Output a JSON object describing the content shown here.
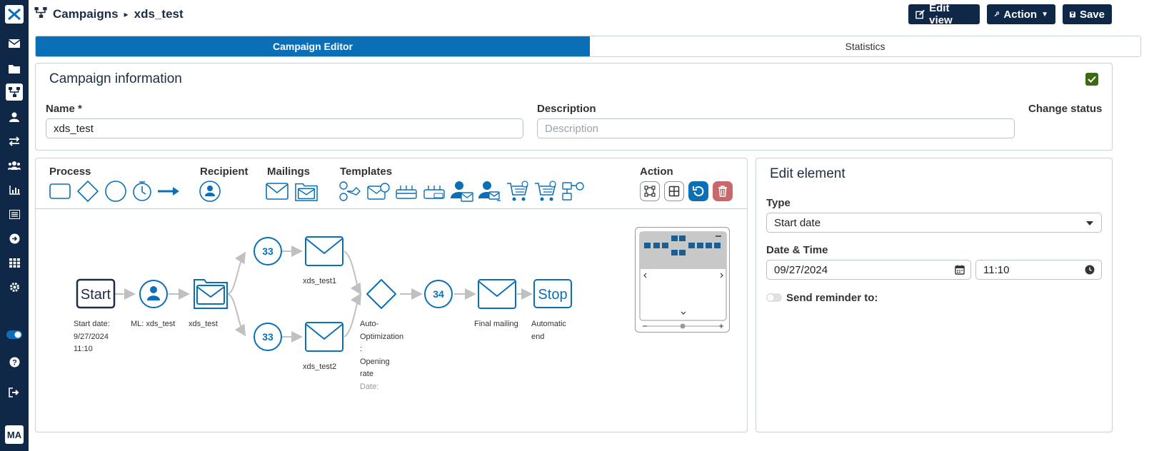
{
  "breadcrumb": {
    "root": "Campaigns",
    "current": "xds_test"
  },
  "header_buttons": {
    "edit_view": "Edit view",
    "action": "Action",
    "save": "Save"
  },
  "tabs": [
    {
      "label": "Campaign Editor",
      "active": true
    },
    {
      "label": "Statistics",
      "active": false
    }
  ],
  "campaign_info": {
    "title": "Campaign information",
    "name_label": "Name *",
    "name_value": "xds_test",
    "description_label": "Description",
    "description_placeholder": "Description",
    "change_status_label": "Change status"
  },
  "toolbar": {
    "process": "Process",
    "recipient": "Recipient",
    "mailings": "Mailings",
    "templates": "Templates",
    "action": "Action"
  },
  "nodes": {
    "start": "Start",
    "stop": "Stop",
    "counter_a": "33",
    "counter_b": "33",
    "counter_c": "34"
  },
  "node_labels": {
    "start_line1": "Start date:",
    "start_line2": "9/27/2024",
    "start_line3": "11:10",
    "recipient": "ML: xds_test",
    "mailing": "xds_test",
    "mail1": "xds_test1",
    "mail2": "xds_test2",
    "opt_line1": "Auto-",
    "opt_line2": "Optimization",
    "opt_line3": ":",
    "opt_line4": "Opening",
    "opt_line5": "rate",
    "opt_line6": "Date:",
    "final": "Final mailing",
    "end_line1": "Automatic",
    "end_line2": "end"
  },
  "edit_element": {
    "title": "Edit element",
    "type_label": "Type",
    "type_value": "Start date",
    "datetime_label": "Date & Time",
    "date_value": "09/27/2024",
    "time_value": "11:10",
    "reminder_label": "Send reminder to:"
  },
  "sidebar": {
    "avatar": "MA"
  },
  "colors": {
    "navy": "#0f2847",
    "blue": "#0b6fb8",
    "green": "#3c6b12",
    "red": "#c8686a"
  }
}
